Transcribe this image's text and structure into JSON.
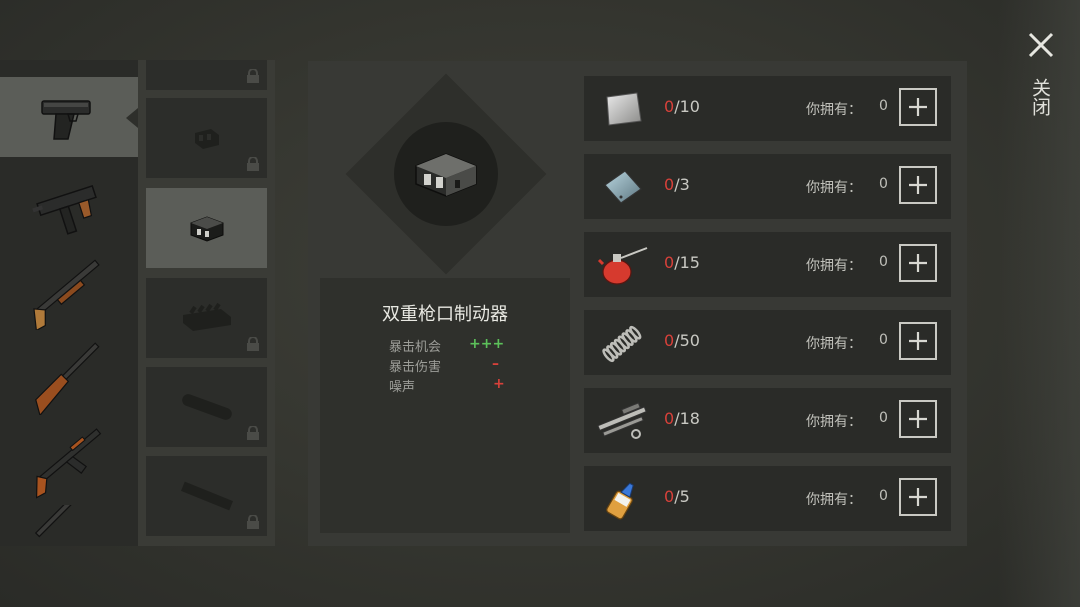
{
  "weapons": {
    "items": [
      {
        "icon": "pistol-icon",
        "selected": true
      },
      {
        "icon": "uzi-icon",
        "selected": false
      },
      {
        "icon": "shotgun-icon",
        "selected": false
      },
      {
        "icon": "rifle-icon",
        "selected": false
      },
      {
        "icon": "ak-rifle-icon",
        "selected": false
      },
      {
        "icon": "sniper-rifle-icon",
        "selected": false
      }
    ]
  },
  "attachments": {
    "items": [
      {
        "icon": "attachment-icon",
        "locked": true
      },
      {
        "icon": "muzzle-compensator-icon",
        "locked": true
      },
      {
        "icon": "double-muzzle-brake-icon",
        "locked": false,
        "selected": true
      },
      {
        "icon": "magazine-icon",
        "locked": true
      },
      {
        "icon": "silencer-icon",
        "locked": true
      },
      {
        "icon": "extended-barrel-icon",
        "locked": true
      }
    ]
  },
  "item": {
    "icon": "double-muzzle-brake-icon",
    "name": "双重枪口制动器",
    "stats": [
      {
        "label": "暴击机会",
        "value": "+++",
        "color": "#5cc05a"
      },
      {
        "label": "暴击伤害",
        "value": "–",
        "color": "#d8413a"
      },
      {
        "label": "噪声",
        "value": "+",
        "color": "#d8413a"
      }
    ]
  },
  "materials": {
    "own_label": "你拥有：",
    "rows": [
      {
        "icon": "metal-plate-icon",
        "have": "0",
        "need": "/10",
        "own": "0"
      },
      {
        "icon": "steel-sheet-icon",
        "have": "0",
        "need": "/3",
        "own": "0"
      },
      {
        "icon": "oil-can-icon",
        "have": "0",
        "need": "/15",
        "own": "0"
      },
      {
        "icon": "spring-icon",
        "have": "0",
        "need": "/50",
        "own": "0"
      },
      {
        "icon": "gun-parts-icon",
        "have": "0",
        "need": "/18",
        "own": "0"
      },
      {
        "icon": "glue-bottle-icon",
        "have": "0",
        "need": "/5",
        "own": "0"
      }
    ]
  },
  "close": {
    "label": "关闭"
  },
  "colors": {
    "accent_red": "#d8413a",
    "accent_green": "#5cc05a"
  }
}
